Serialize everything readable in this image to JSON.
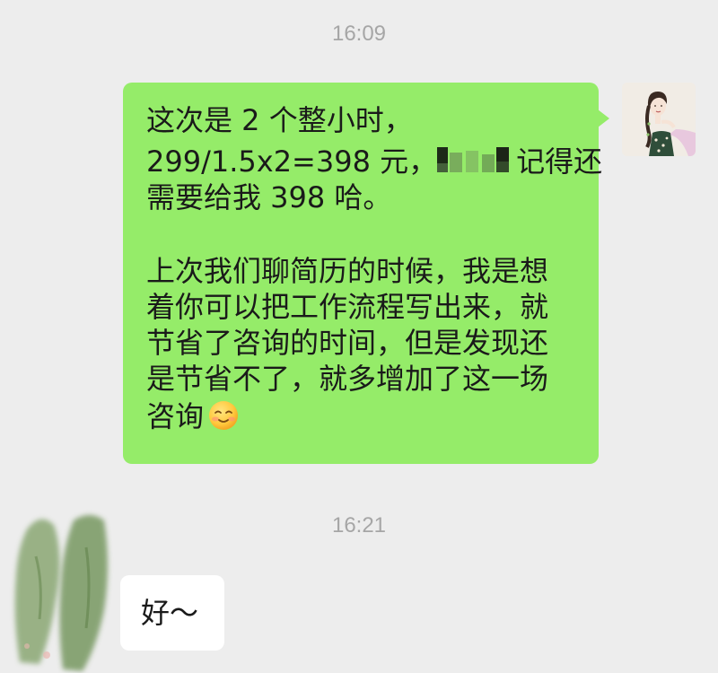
{
  "chat": {
    "messages": [
      {
        "type": "timestamp",
        "text": "16:09"
      },
      {
        "type": "outgoing",
        "lines": [
          "这次是 2 个整小时，",
          "299/1.5x2=398 元，",
          "记得还",
          "需要给我 398 哈。",
          "上次我们聊简历的时候，我是想",
          "着你可以把工作流程写出来，就",
          "节省了咨询的时间，但是发现还",
          "是节省不了，就多增加了这一场",
          "咨询"
        ],
        "emoji": "smiling-face-emoji"
      },
      {
        "type": "timestamp",
        "text": "16:21"
      },
      {
        "type": "incoming",
        "text": "好～"
      }
    ]
  },
  "colors": {
    "background": "#ededed",
    "outgoing_bubble": "#95ec69",
    "incoming_bubble": "#ffffff",
    "timestamp": "#a6a6a6",
    "message_text": "#1a1a1a"
  },
  "icons": {
    "sender_avatar": "avatar",
    "receiver_avatar": "brush-avatar-decoration",
    "redaction": "mosaic-redaction"
  }
}
